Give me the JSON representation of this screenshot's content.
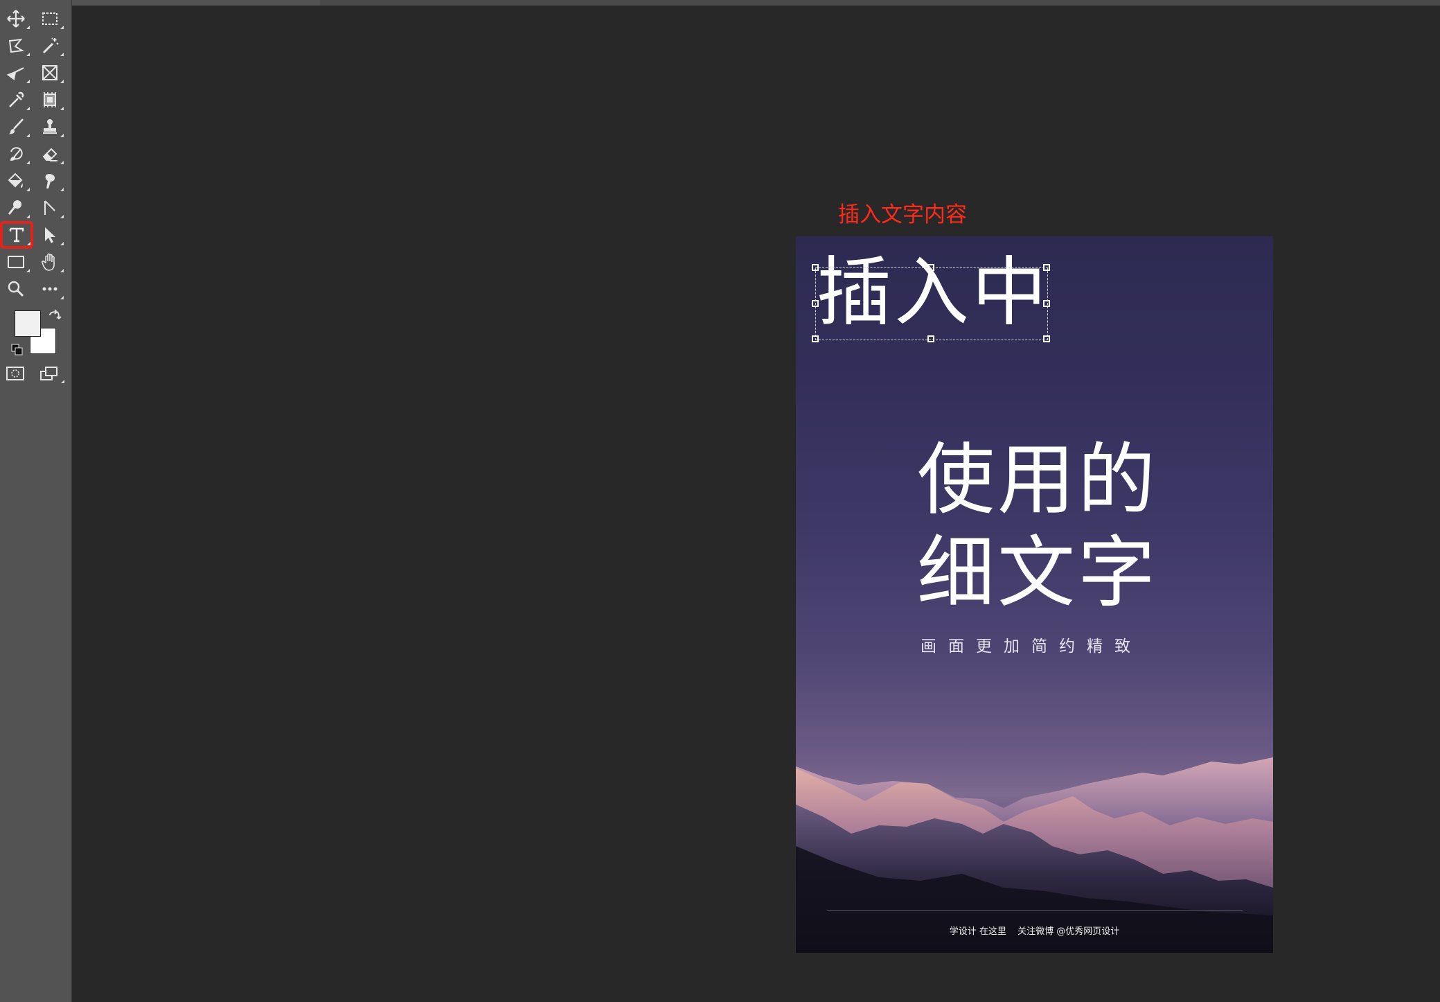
{
  "toolbar": {
    "tools": [
      {
        "icon": "move-icon"
      },
      {
        "icon": "rectangular-marquee-icon"
      },
      {
        "icon": "lasso-icon"
      },
      {
        "icon": "magic-wand-icon"
      },
      {
        "icon": "crop-icon"
      },
      {
        "icon": "frame-icon"
      },
      {
        "icon": "eyedropper-icon"
      },
      {
        "icon": "healing-patch-icon"
      },
      {
        "icon": "brush-icon"
      },
      {
        "icon": "clone-stamp-icon"
      },
      {
        "icon": "history-brush-icon"
      },
      {
        "icon": "eraser-icon"
      },
      {
        "icon": "paint-bucket-icon"
      },
      {
        "icon": "smudge-icon"
      },
      {
        "icon": "dodge-icon"
      },
      {
        "icon": "pen-icon"
      },
      {
        "icon": "type-icon",
        "selected": true
      },
      {
        "icon": "path-selection-icon"
      },
      {
        "icon": "rectangle-shape-icon"
      },
      {
        "icon": "hand-icon"
      },
      {
        "icon": "zoom-icon"
      },
      {
        "icon": "more-tools-icon"
      }
    ],
    "foreground_color": "#f0f0f0",
    "background_color": "#ffffff",
    "selection_highlight_color": "#e0241b"
  },
  "annotation": {
    "text": "插入文字内容",
    "color": "#ff2a1a"
  },
  "poster": {
    "heading": "插入中",
    "title_line1": "使用的",
    "title_line2": "细文字",
    "subtitle": "画面更加简约精致",
    "footer_left": "学设计 在这里",
    "footer_right": "关注微博 @优秀网页设计"
  }
}
